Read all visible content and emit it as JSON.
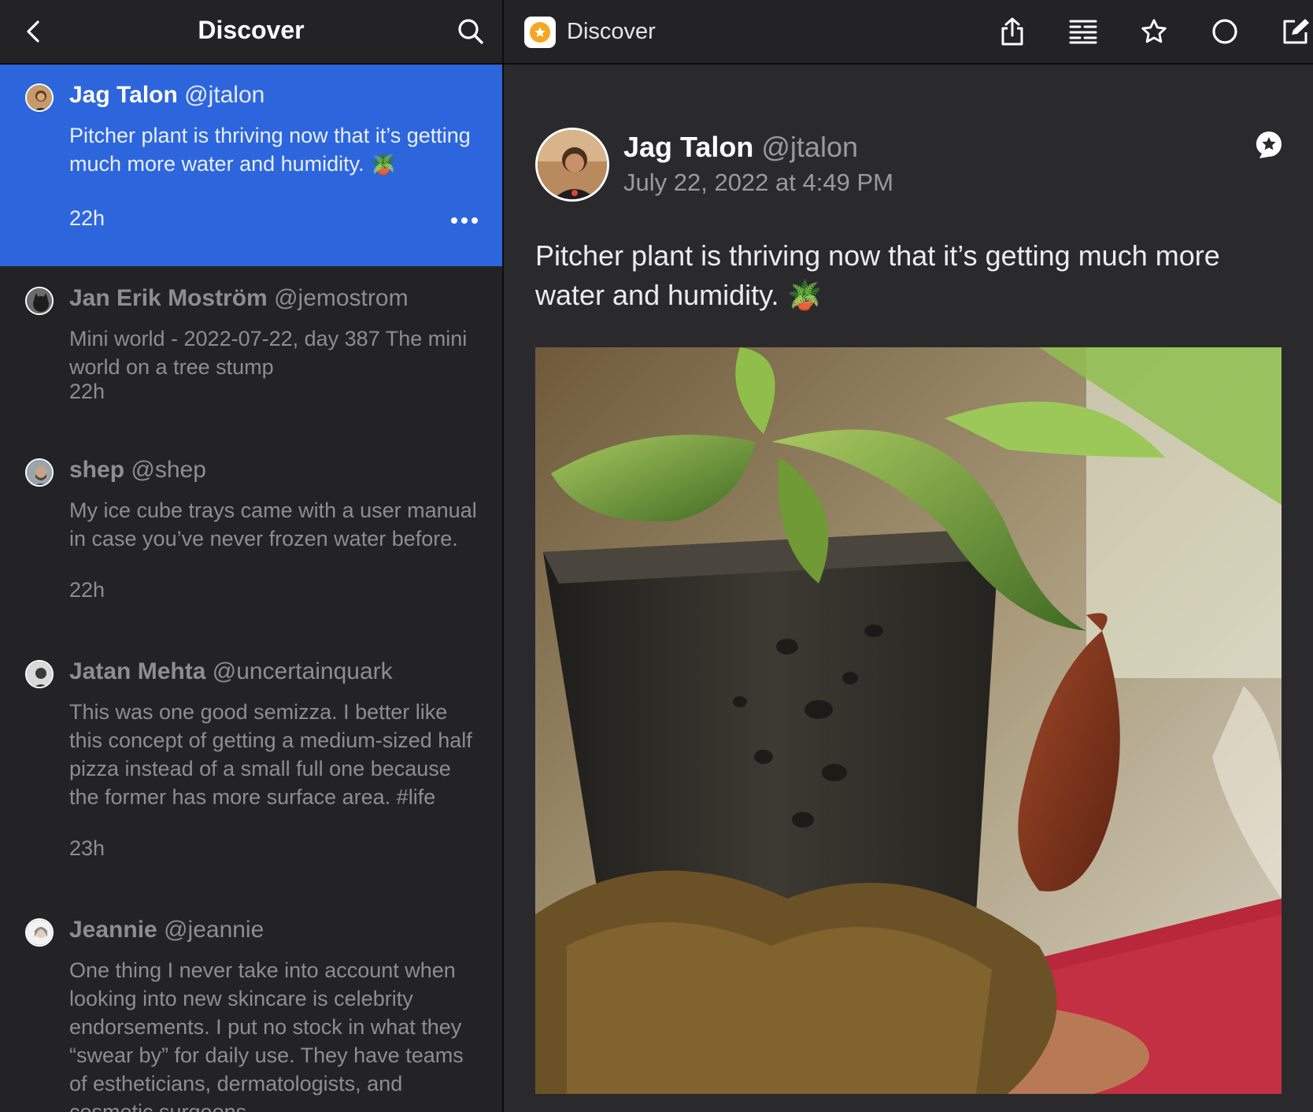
{
  "left_header": {
    "title": "Discover",
    "back_icon": "chevron-left-icon",
    "search_icon": "search-icon"
  },
  "posts": [
    {
      "name": "Jag Talon",
      "handle": "@jtalon",
      "body": "Pitcher plant is thriving now that it’s getting much more water and humidity. 🪴",
      "time": "22h",
      "selected": true
    },
    {
      "name": "Jan Erik Moström",
      "handle": "@jemostrom",
      "body": "Mini world - 2022-07-22, day 387 The mini world on a tree stump",
      "time": "22h"
    },
    {
      "name": "shep",
      "handle": "@shep",
      "body": "My ice cube trays came with a user manual in case you’ve never frozen water before.",
      "time": "22h"
    },
    {
      "name": "Jatan Mehta",
      "handle": "@uncertainquark",
      "body": "This was one good semizza. I better like this concept of getting a medium-sized half pizza instead of a small full one because the former has more surface area. #life",
      "time": "23h"
    },
    {
      "name": "Jeannie",
      "handle": "@jeannie",
      "body": "One thing I never take into account when looking into new skincare is celebrity endorsements. I put no stock in what they “swear by” for daily use. They have teams of estheticians, dermatologists, and cosmetic surgeons",
      "time": ""
    }
  ],
  "right_header": {
    "title": "Discover",
    "icons": [
      "share-icon",
      "reader-view-icon",
      "star-icon",
      "circle-icon",
      "compose-icon"
    ]
  },
  "detail": {
    "name": "Jag Talon",
    "handle": "@jtalon",
    "date": "July 22, 2022 at 4:49 PM",
    "body": "Pitcher plant is thriving now that it’s getting much more water and humidity. 🪴",
    "photo_subject": "pitcher-plant-photo"
  },
  "colors": {
    "selected": "#2d66dc",
    "background": "#2a2a2c",
    "sidebar": "#232325",
    "muted_text": "#8d8d92",
    "app_icon": "#f6a623"
  }
}
